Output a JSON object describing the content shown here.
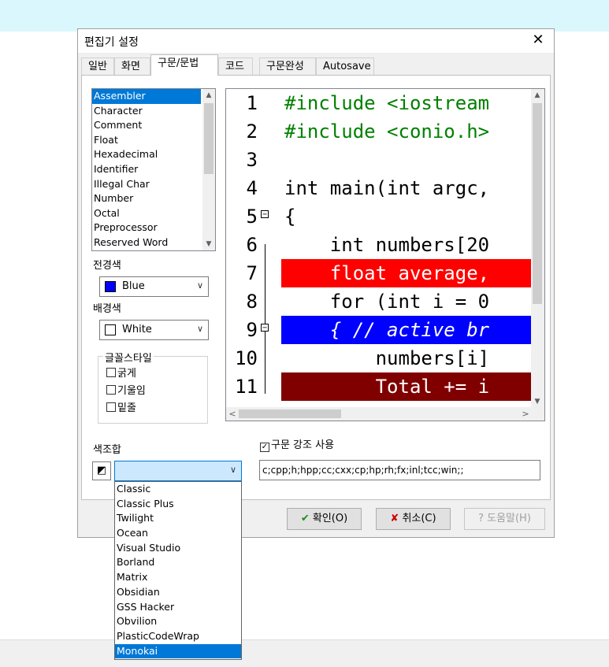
{
  "dialog": {
    "title": "편집기 설정",
    "close_glyph": "✕",
    "tabs": [
      {
        "label": "일반"
      },
      {
        "label": "화면"
      },
      {
        "label": "구문/문법"
      },
      {
        "label": "코드"
      },
      {
        "label": "구문완성"
      },
      {
        "label": "Autosave"
      }
    ],
    "active_tab": "구문/문법"
  },
  "element_list": {
    "items": [
      "Assembler",
      "Character",
      "Comment",
      "Float",
      "Hexadecimal",
      "Identifier",
      "Illegal Char",
      "Number",
      "Octal",
      "Preprocessor",
      "Reserved Word"
    ],
    "selected": "Assembler"
  },
  "foreground": {
    "label": "전경색",
    "value": "Blue",
    "swatch": "#0000ff"
  },
  "background": {
    "label": "배경색",
    "value": "White",
    "swatch": "#ffffff"
  },
  "font_style": {
    "label": "글꼴스타일",
    "bold": "굵게",
    "italic": "기울임",
    "underline": "밑줄"
  },
  "editor": {
    "lines": [
      {
        "num": "1",
        "text": "#include <iostream",
        "fold": "",
        "bg": "",
        "color": "#008000",
        "weight": "normal",
        "style": "normal"
      },
      {
        "num": "2",
        "text": "#include <conio.h>",
        "fold": "",
        "bg": "",
        "color": "#008000",
        "weight": "normal",
        "style": "normal"
      },
      {
        "num": "3",
        "text": "",
        "fold": "",
        "bg": "",
        "color": "#000000",
        "weight": "normal",
        "style": "normal"
      },
      {
        "num": "4",
        "text": "int main(int argc,",
        "fold": "",
        "bg": "",
        "color": "#000000",
        "weight": "normal",
        "style": "normal"
      },
      {
        "num": "5",
        "text": "{",
        "fold": "−",
        "bg": "",
        "color": "#000000",
        "weight": "normal",
        "style": "normal"
      },
      {
        "num": "6",
        "text": "    int numbers[20",
        "fold": "",
        "bg": "",
        "color": "#000000",
        "weight": "normal",
        "style": "normal"
      },
      {
        "num": "7",
        "text": "    float average,",
        "fold": "",
        "bg": "#ff0000",
        "color": "#ffffff",
        "weight": "normal",
        "style": "normal"
      },
      {
        "num": "8",
        "text": "    for (int i = 0",
        "fold": "",
        "bg": "",
        "color": "#000000",
        "weight": "normal",
        "style": "normal"
      },
      {
        "num": "9",
        "text": "    { // active br",
        "fold": "−",
        "bg": "#0000ff",
        "color": "#ffffff",
        "weight": "normal",
        "style": "italic"
      },
      {
        "num": "10",
        "text": "        numbers[i]",
        "fold": "",
        "bg": "",
        "color": "#000000",
        "weight": "normal",
        "style": "normal"
      },
      {
        "num": "11",
        "text": "        Total += i",
        "fold": "",
        "bg": "#800000",
        "color": "#ffffff",
        "weight": "normal",
        "style": "normal"
      }
    ]
  },
  "syntax_highlight": {
    "label": "구문 강조 사용",
    "checked": true,
    "check_glyph": "✓"
  },
  "extensions": {
    "value": "c;cpp;h;hpp;cc;cxx;cp;hp;rh;fx;inl;tcc;win;;"
  },
  "color_scheme": {
    "label": "색조합",
    "button_icon": "scheme-icon",
    "current": "",
    "options": [
      "Classic",
      "Classic Plus",
      "Twilight",
      "Ocean",
      "Visual Studio",
      "Borland",
      "Matrix",
      "Obsidian",
      "GSS Hacker",
      "Obvilion",
      "PlasticCodeWrap",
      "Monokai"
    ],
    "highlighted": "Monokai"
  },
  "buttons": {
    "ok": "확인(O)",
    "cancel": "취소(C)",
    "help": "도움말(H)"
  }
}
